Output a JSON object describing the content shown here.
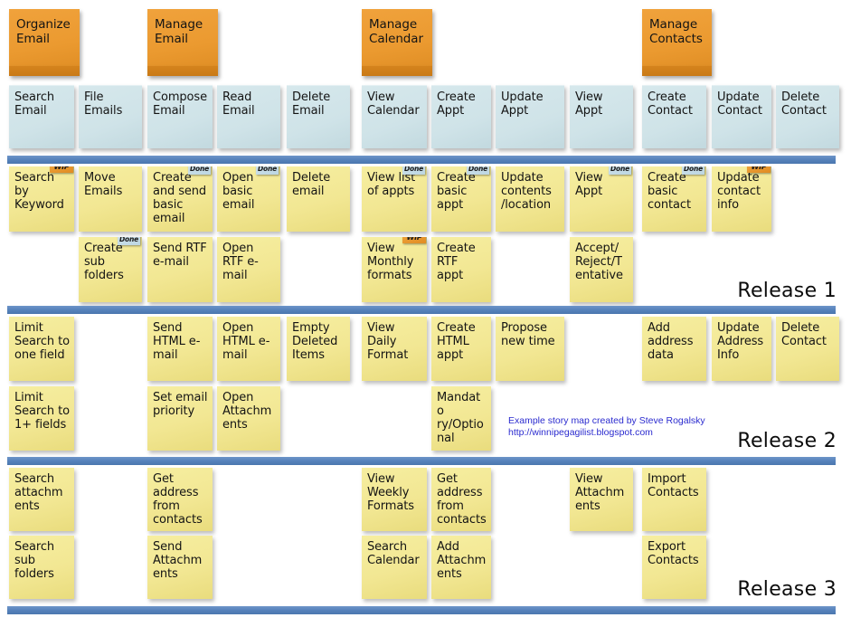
{
  "meta": {
    "title": "Agile Story Map",
    "credit_line_1": "Example story map created by Steve Rogalsky",
    "credit_line_2": "http://winnipegagilist.blogspot.com",
    "colors": {
      "activity": "#eb9a30",
      "task": "#cfe3e8",
      "story": "#f2e793",
      "bar": "#5682bb",
      "credit_text": "#2b2bcf",
      "badge_done": "#c4dbe6",
      "badge_wip": "#e8932b"
    }
  },
  "activities": [
    {
      "label": "Organize Email",
      "col": 0
    },
    {
      "label": "Manage Email",
      "col": 2
    },
    {
      "label": "Manage Calendar",
      "col": 5
    },
    {
      "label": "Manage Contacts",
      "col": 9
    }
  ],
  "tasks": [
    {
      "label": "Search Email",
      "col": 0
    },
    {
      "label": "File Emails",
      "col": 1
    },
    {
      "label": "Compose Email",
      "col": 2
    },
    {
      "label": "Read Email",
      "col": 3
    },
    {
      "label": "Delete Email",
      "col": 4
    },
    {
      "label": "View Calendar",
      "col": 5
    },
    {
      "label": "Create Appt",
      "col": 6
    },
    {
      "label": "Update Appt",
      "col": 7
    },
    {
      "label": "View Appt",
      "col": 8
    },
    {
      "label": "Create Contact",
      "col": 9
    },
    {
      "label": "Update Contact",
      "col": 10
    },
    {
      "label": "Delete Contact",
      "col": 11
    }
  ],
  "releases": [
    {
      "name": "Release 1",
      "rows": [
        [
          {
            "label": "Search by Keyword",
            "col": 0,
            "badge": "WIP"
          },
          {
            "label": "Move Emails",
            "col": 1,
            "badge": null
          },
          {
            "label": "Create and send basic email",
            "col": 2,
            "badge": "Done"
          },
          {
            "label": "Open basic email",
            "col": 3,
            "badge": "Done"
          },
          {
            "label": "Delete email",
            "col": 4,
            "badge": null
          },
          {
            "label": "View list of appts",
            "col": 5,
            "badge": "Done"
          },
          {
            "label": "Create basic appt",
            "col": 6,
            "badge": "Done"
          },
          {
            "label": "Update contents /location",
            "col": 7,
            "badge": null
          },
          {
            "label": "View Appt",
            "col": 8,
            "badge": "Done"
          },
          {
            "label": "Create basic contact",
            "col": 9,
            "badge": "Done"
          },
          {
            "label": "Update contact info",
            "col": 10,
            "badge": "WIP"
          }
        ],
        [
          {
            "label": "Create sub folders",
            "col": 1,
            "badge": "Done"
          },
          {
            "label": "Send RTF e-mail",
            "col": 2,
            "badge": null
          },
          {
            "label": "Open RTF e-mail",
            "col": 3,
            "badge": null
          },
          {
            "label": "View Monthly formats",
            "col": 5,
            "badge": "WIP"
          },
          {
            "label": "Create RTF appt",
            "col": 6,
            "badge": null
          },
          {
            "label": "Accept/ Reject/T entative",
            "col": 8,
            "badge": null
          }
        ]
      ]
    },
    {
      "name": "Release 2",
      "rows": [
        [
          {
            "label": "Limit Search to one field",
            "col": 0,
            "badge": null
          },
          {
            "label": "Send HTML e-mail",
            "col": 2,
            "badge": null
          },
          {
            "label": "Open HTML e-mail",
            "col": 3,
            "badge": null
          },
          {
            "label": "Empty Deleted Items",
            "col": 4,
            "badge": null
          },
          {
            "label": "View Daily Format",
            "col": 5,
            "badge": null
          },
          {
            "label": "Create HTML appt",
            "col": 6,
            "badge": null
          },
          {
            "label": "Propose new time",
            "col": 7,
            "badge": null
          },
          {
            "label": "Add address data",
            "col": 9,
            "badge": null
          },
          {
            "label": "Update Address Info",
            "col": 10,
            "badge": null
          },
          {
            "label": "Delete Contact",
            "col": 11,
            "badge": null
          }
        ],
        [
          {
            "label": "Limit Search to 1+ fields",
            "col": 0,
            "badge": null
          },
          {
            "label": "Set email priority",
            "col": 2,
            "badge": null
          },
          {
            "label": "Open Attachm ents",
            "col": 3,
            "badge": null
          },
          {
            "label": "Mandato ry/Optio nal",
            "col": 6,
            "badge": null
          }
        ]
      ]
    },
    {
      "name": "Release 3",
      "rows": [
        [
          {
            "label": "Search attachm ents",
            "col": 0,
            "badge": null
          },
          {
            "label": "Get address from contacts",
            "col": 2,
            "badge": null
          },
          {
            "label": "View Weekly Formats",
            "col": 5,
            "badge": null
          },
          {
            "label": "Get address from contacts",
            "col": 6,
            "badge": null
          },
          {
            "label": "View Attachm ents",
            "col": 8,
            "badge": null
          },
          {
            "label": "Import Contacts",
            "col": 9,
            "badge": null
          }
        ],
        [
          {
            "label": "Search sub folders",
            "col": 0,
            "badge": null
          },
          {
            "label": "Send Attachm ents",
            "col": 2,
            "badge": null
          },
          {
            "label": "Search Calendar",
            "col": 5,
            "badge": null
          },
          {
            "label": "Add Attachm ents",
            "col": 6,
            "badge": null
          },
          {
            "label": "Export Contacts",
            "col": 9,
            "badge": null
          }
        ]
      ]
    }
  ]
}
